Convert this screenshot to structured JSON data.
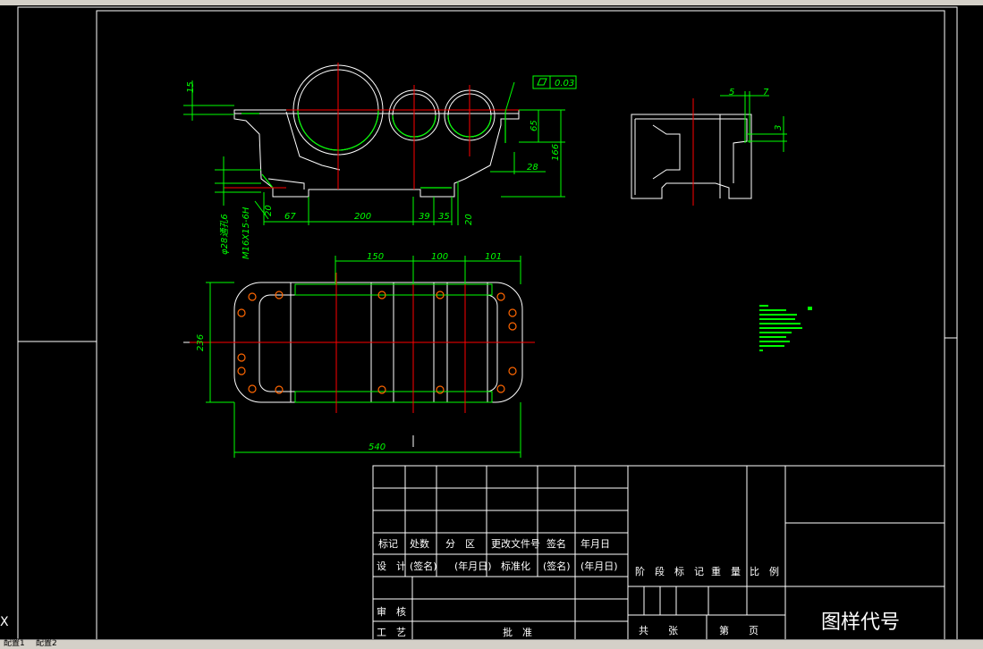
{
  "colors": {
    "background": "#000000",
    "outline": "#ffffff",
    "dimension": "#00ff00",
    "centerline": "#ff0000"
  },
  "side_view": {
    "dims": {
      "d15": "15",
      "d65": "65",
      "d166": "166",
      "d28": "28",
      "d20a": "20",
      "d67": "67",
      "d200": "200",
      "d39": "39",
      "d35": "35",
      "d20b": "20"
    },
    "tolerance": {
      "flatness": "0.03"
    },
    "hole_note": {
      "line1": "φ28通孔6",
      "line2": "M16X15-6H"
    }
  },
  "end_view": {
    "dims": {
      "d5": "5",
      "d7": "7",
      "d3": "3"
    }
  },
  "plan_view": {
    "dims": {
      "d150": "150",
      "d100": "100",
      "d101": "101",
      "d236": "236",
      "d540": "540"
    }
  },
  "title_block": {
    "row_header": [
      "标记",
      "处数",
      "分　区",
      "更改文件号",
      "签名",
      "年月日"
    ],
    "row_design": [
      "设　计",
      "(签名)",
      "(年月日)",
      "标准化",
      "(签名)",
      "(年月日)"
    ],
    "review": "审　核",
    "process": "工　艺",
    "approve": "批　准",
    "stage_mark": "阶　段　标　记",
    "weight": "重　量",
    "scale": "比　例",
    "sheets_total": "共　　张",
    "sheet_no": "第　　页",
    "drawing_code": "图样代号"
  },
  "ucs_mark": "X",
  "layout_tabs": [
    "配置1",
    "配置2"
  ]
}
